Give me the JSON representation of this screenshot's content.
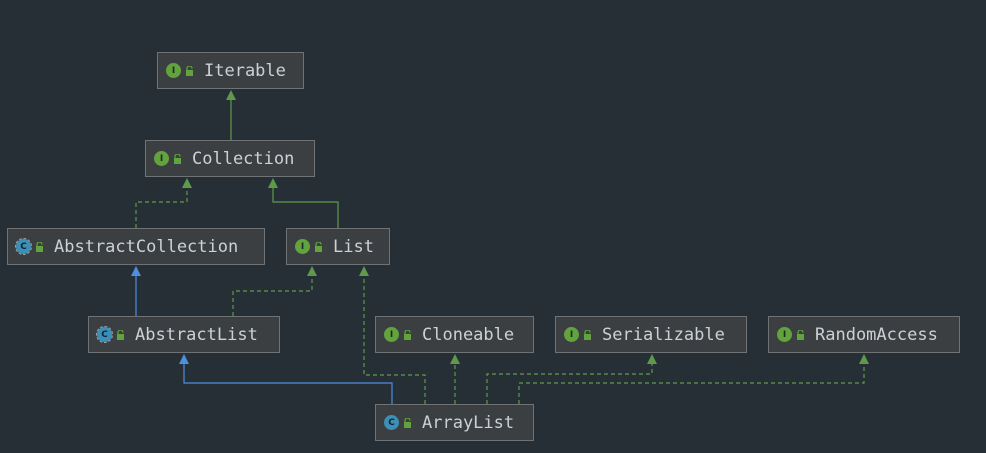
{
  "diagram": {
    "colors": {
      "background": "#262f36",
      "node_fill": "#3b3f41",
      "node_border": "#6f7375",
      "text": "#cbd1d6",
      "extends_edge": "#4f8fe0",
      "implements_edge": "#5f9a4a",
      "interface_badge": "#62a33d",
      "class_badge": "#3c8fb7"
    },
    "nodes": [
      {
        "id": "iterable",
        "label": "Iterable",
        "kind": "interface",
        "badge": "I",
        "icon": "interface-icon"
      },
      {
        "id": "collection",
        "label": "Collection",
        "kind": "interface",
        "badge": "I",
        "icon": "interface-icon"
      },
      {
        "id": "abstractcollection",
        "label": "AbstractCollection",
        "kind": "abstract",
        "badge": "C",
        "icon": "abstract-class-icon"
      },
      {
        "id": "list",
        "label": "List",
        "kind": "interface",
        "badge": "I",
        "icon": "interface-icon"
      },
      {
        "id": "abstractlist",
        "label": "AbstractList",
        "kind": "abstract",
        "badge": "C",
        "icon": "abstract-class-icon"
      },
      {
        "id": "cloneable",
        "label": "Cloneable",
        "kind": "interface",
        "badge": "I",
        "icon": "interface-icon"
      },
      {
        "id": "serializable",
        "label": "Serializable",
        "kind": "interface",
        "badge": "I",
        "icon": "interface-icon"
      },
      {
        "id": "randomaccess",
        "label": "RandomAccess",
        "kind": "interface",
        "badge": "I",
        "icon": "interface-icon"
      },
      {
        "id": "arraylist",
        "label": "ArrayList",
        "kind": "class",
        "badge": "C",
        "icon": "class-icon"
      }
    ],
    "edges": [
      {
        "from": "collection",
        "to": "iterable",
        "type": "extends-interface"
      },
      {
        "from": "abstractcollection",
        "to": "collection",
        "type": "implements"
      },
      {
        "from": "list",
        "to": "collection",
        "type": "extends-interface"
      },
      {
        "from": "abstractlist",
        "to": "abstractcollection",
        "type": "extends"
      },
      {
        "from": "abstractlist",
        "to": "list",
        "type": "implements"
      },
      {
        "from": "arraylist",
        "to": "abstractlist",
        "type": "extends"
      },
      {
        "from": "arraylist",
        "to": "list",
        "type": "implements"
      },
      {
        "from": "arraylist",
        "to": "cloneable",
        "type": "implements"
      },
      {
        "from": "arraylist",
        "to": "serializable",
        "type": "implements"
      },
      {
        "from": "arraylist",
        "to": "randomaccess",
        "type": "implements"
      }
    ]
  }
}
